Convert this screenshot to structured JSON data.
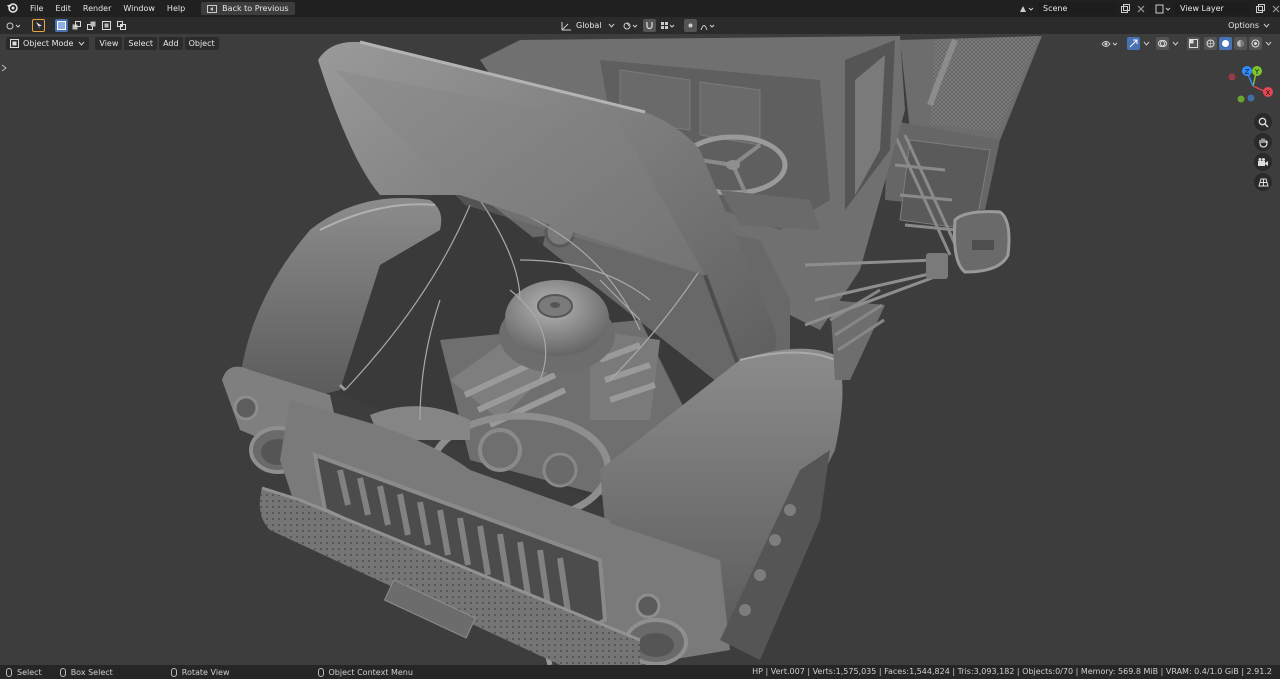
{
  "topbar": {
    "menus": [
      "File",
      "Edit",
      "Render",
      "Window",
      "Help"
    ],
    "back_button": "Back to Previous",
    "transform_orientation": "Global",
    "scene": "Scene",
    "view_layer": "View Layer"
  },
  "header": {
    "options": "Options"
  },
  "viewport_header": {
    "mode": "Object Mode",
    "menus": [
      "View",
      "Select",
      "Add",
      "Object"
    ]
  },
  "gizmo": {
    "axes": [
      "X",
      "Y",
      "Z"
    ],
    "colors": {
      "x": "#e64552",
      "y": "#7bc62d",
      "z": "#2c8fff"
    }
  },
  "status": {
    "select": "Select",
    "box_select": "Box Select",
    "rotate": "Rotate View",
    "context_menu": "Object Context Menu",
    "stats": "HP | Vert.007 | Verts:1,575,035 | Faces:1,544,824 | Tris:3,093,182 | Objects:0/70 | Memory: 569.8 MiB | VRAM: 0.4/1.0 GiB | 2.91.2"
  },
  "colors": {
    "viewport_bg": "#3d3d3d",
    "active_blue": "#4772b3",
    "model_gray": "#8a8a8a"
  }
}
